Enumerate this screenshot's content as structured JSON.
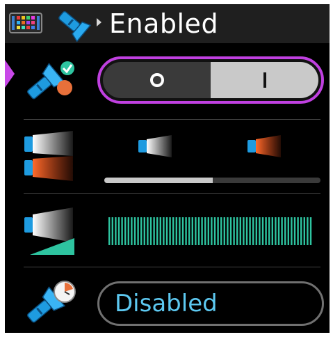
{
  "header": {
    "title": "Enabled",
    "icons": [
      "app-menu-icon",
      "flashlight-icon",
      "breadcrumb-arrow-icon"
    ]
  },
  "rows": {
    "power": {
      "icon": "flashlight-power-icon",
      "selected": true,
      "toggle": {
        "off_symbol": "O",
        "on_symbol": "I",
        "active": "on"
      }
    },
    "mode": {
      "icon": "flashlight-modes-icon",
      "options": [
        {
          "name": "white",
          "icon": "flashlight-white-icon"
        },
        {
          "name": "red",
          "icon": "flashlight-red-icon"
        }
      ],
      "selected_index": 0
    },
    "brightness": {
      "icon": "flashlight-brightness-icon",
      "level": 1.0
    },
    "auto_off": {
      "icon": "flashlight-timer-icon",
      "value": "Disabled"
    }
  },
  "colors": {
    "accent": "#c040e0",
    "value_text": "#5dc8f0",
    "level_bar": "#2ec4a0",
    "header_bg": "#1f1f1f",
    "flashlight_blue": "#1e9be0",
    "red_beam": "#e8501e"
  }
}
